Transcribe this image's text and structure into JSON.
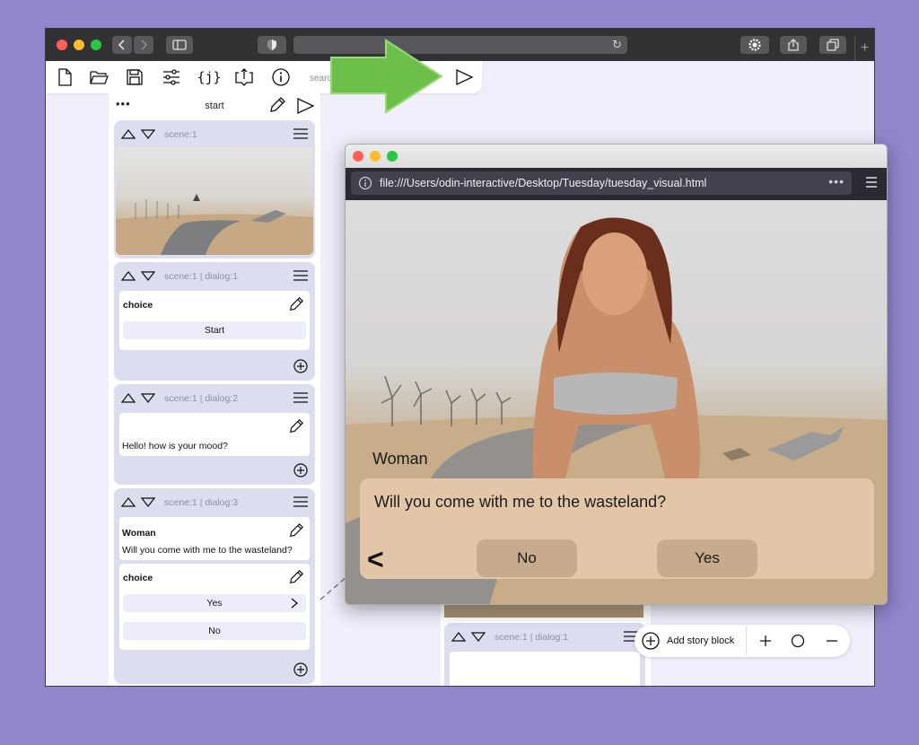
{
  "colors": {
    "desktop": "#8f86cc",
    "accent_green": "#6cc04a",
    "block_bg": "#ddddf0",
    "dialog_bg": "#e3c6a7",
    "dialog_button": "#c8ab8e"
  },
  "toolbar": {
    "search_placeholder": "searc",
    "icons": [
      "new-file-icon",
      "open-folder-icon",
      "save-icon",
      "settings-sliders-icon",
      "json-icon",
      "export-icon",
      "info-icon",
      "play-icon"
    ]
  },
  "column": {
    "title": "start",
    "blocks": [
      {
        "label": "scene:1"
      },
      {
        "label": "scene:1 | dialog:1",
        "card_title": "choice",
        "choices": [
          "Start"
        ]
      },
      {
        "label": "scene:1 | dialog:2",
        "text": "Hello! how is your mood?"
      },
      {
        "label": "scene:1 | dialog:3",
        "speaker": "Woman",
        "text": "Will you come with me to the wasteland?",
        "card_title": "choice",
        "choices": [
          "Yes",
          "No"
        ]
      }
    ]
  },
  "column2": {
    "block_label": "scene:1 | dialog:1"
  },
  "preview": {
    "url": "file:///Users/odin-interactive/Desktop/Tuesday/tuesday_visual.html",
    "speaker": "Woman",
    "dialog": "Will you come with me to the wasteland?",
    "back": "<",
    "options": [
      "No",
      "Yes"
    ]
  },
  "float_bar": {
    "add_label": "Add story block"
  }
}
